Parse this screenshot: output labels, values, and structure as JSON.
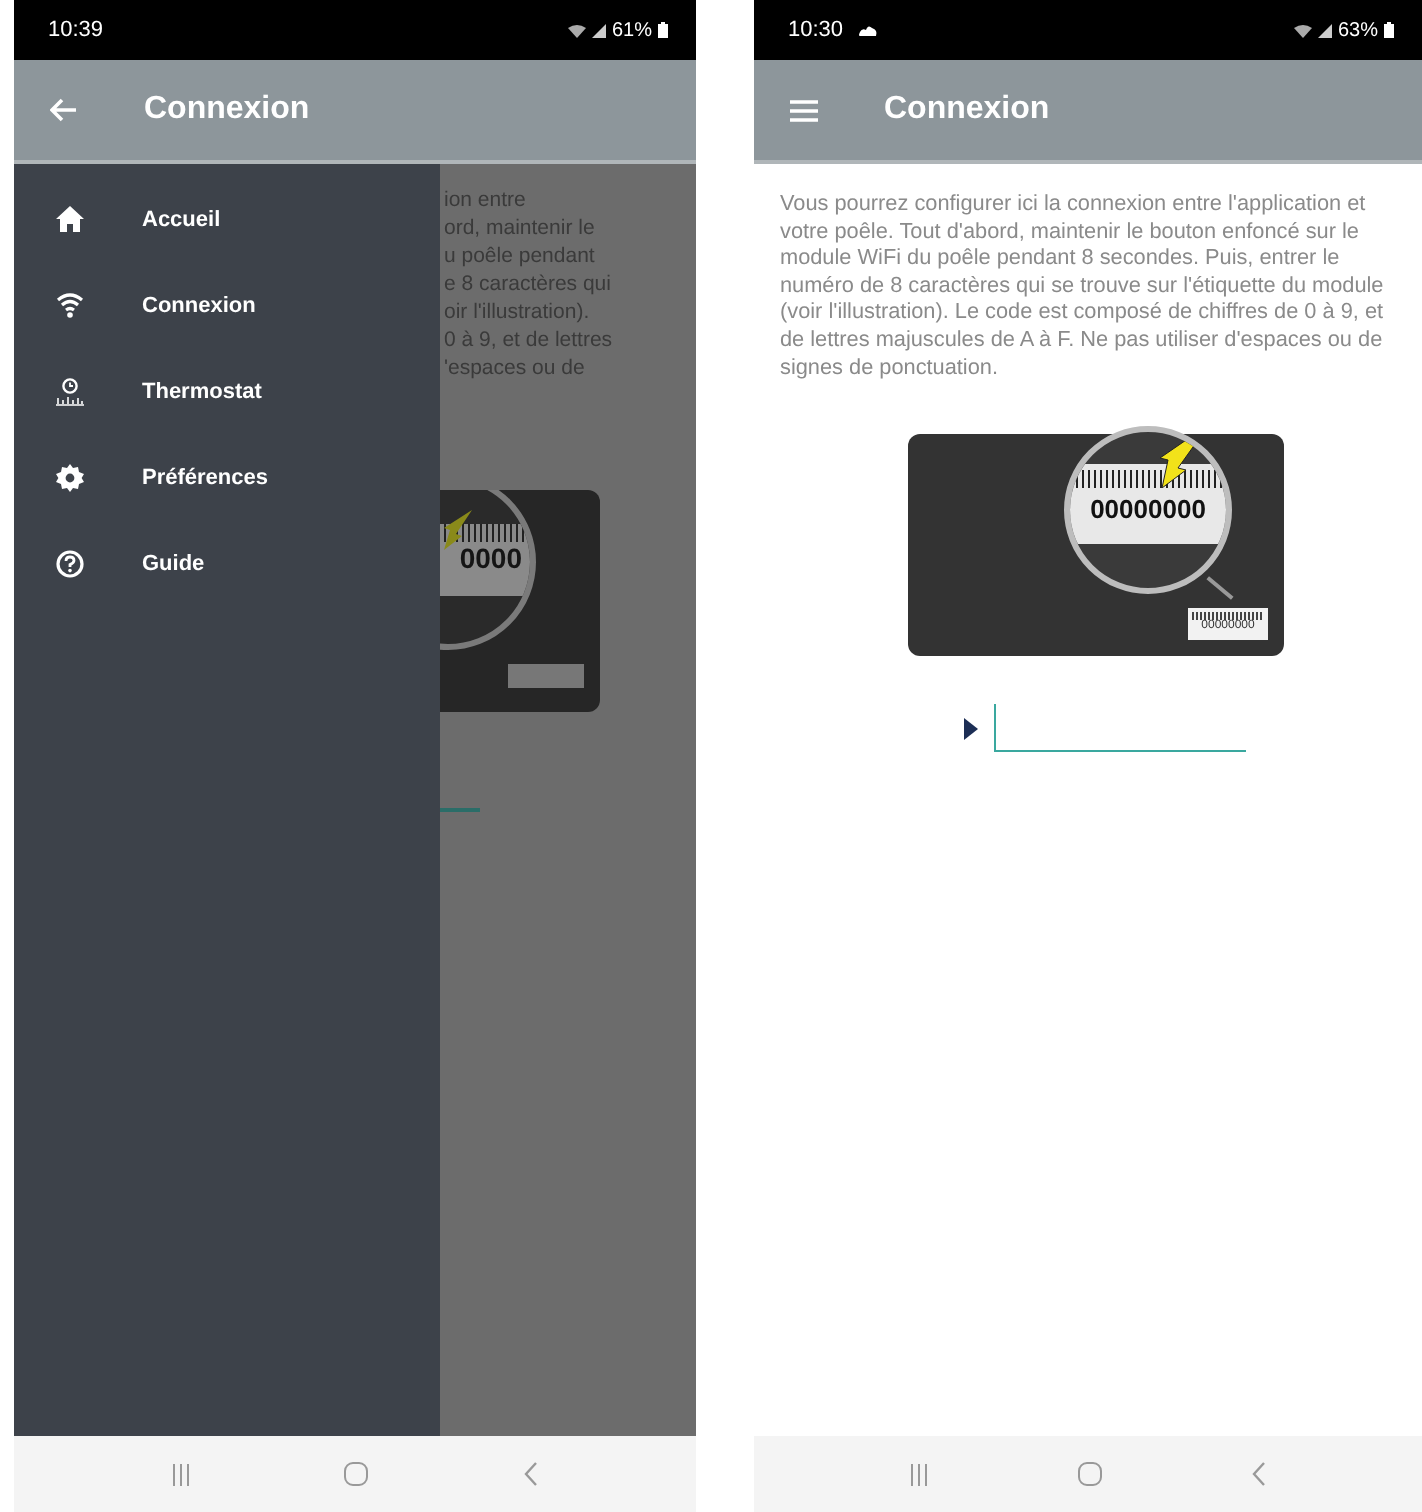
{
  "phones": [
    {
      "status_bar": {
        "time": "10:39",
        "cloud": false,
        "battery": "61%"
      },
      "app_bar": {
        "kind": "back",
        "title": "Connexion"
      },
      "drawer": {
        "items": [
          {
            "kind": "home",
            "label": "Accueil"
          },
          {
            "kind": "wifi",
            "label": "Connexion"
          },
          {
            "kind": "thermostat",
            "label": "Thermostat"
          },
          {
            "kind": "gear",
            "label": "Préférences"
          },
          {
            "kind": "help",
            "label": "Guide"
          }
        ]
      },
      "background_lines": [
        "ion entre",
        "ord, maintenir le",
        "u poêle pendant",
        "e 8 caractères qui",
        "oir l'illustration).",
        "0 à 9, et de lettres",
        "'espaces ou de"
      ],
      "label_code": "0000"
    },
    {
      "status_bar": {
        "time": "10:30",
        "cloud": true,
        "battery": "63%"
      },
      "app_bar": {
        "kind": "menu",
        "title": "Connexion"
      },
      "intro": "Vous pourrez configurer ici la connexion entre l'application et votre poêle. Tout d'abord, maintenir le bouton enfoncé sur le module WiFi du poêle pendant 8 secondes. Puis, entrer le numéro de 8 caractères qui se trouve sur l'étiquette du module (voir l'illustration). Le code est composé de chiffres de 0 à 9, et de lettres majuscules de A à F. Ne pas utiliser d'espaces ou de signes de ponctuation.",
      "label_code": "00000000",
      "small_label_code": "00000000"
    }
  ]
}
